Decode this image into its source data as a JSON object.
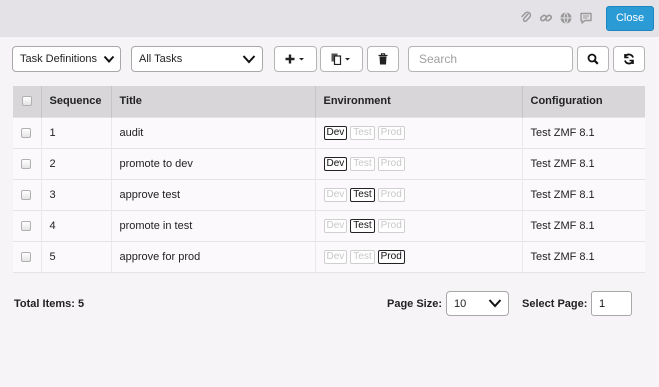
{
  "header": {
    "close_label": "Close",
    "icons": [
      "paperclip-icon",
      "link-icon",
      "globe-icon",
      "comment-icon"
    ]
  },
  "toolbar": {
    "definitions_select": "Task Definitions",
    "tasks_select": "All Tasks",
    "add_icon": "plus-icon",
    "copy_icon": "copy-icon",
    "delete_icon": "trash-icon",
    "search_placeholder": "Search",
    "search_icon": "search-icon",
    "refresh_icon": "refresh-icon"
  },
  "table": {
    "columns": [
      "Sequence",
      "Title",
      "Environment",
      "Configuration"
    ],
    "env_labels": [
      "Dev",
      "Test",
      "Prod"
    ],
    "rows": [
      {
        "seq": "1",
        "title": "audit",
        "active_env": "Dev",
        "config": "Test ZMF 8.1"
      },
      {
        "seq": "2",
        "title": "promote to dev",
        "active_env": "Dev",
        "config": "Test ZMF 8.1"
      },
      {
        "seq": "3",
        "title": "approve test",
        "active_env": "Test",
        "config": "Test ZMF 8.1"
      },
      {
        "seq": "4",
        "title": "promote in test",
        "active_env": "Test",
        "config": "Test ZMF 8.1"
      },
      {
        "seq": "5",
        "title": "approve for prod",
        "active_env": "Prod",
        "config": "Test ZMF 8.1"
      }
    ]
  },
  "footer": {
    "total_label": "Total Items: 5",
    "page_size_label": "Page Size:",
    "page_size_value": "10",
    "select_page_label": "Select Page:",
    "select_page_value": "1"
  },
  "colors": {
    "accent": "#2b9bd6",
    "header_bg": "#d8d6d9",
    "topbar_bg": "#e4e2e6"
  }
}
